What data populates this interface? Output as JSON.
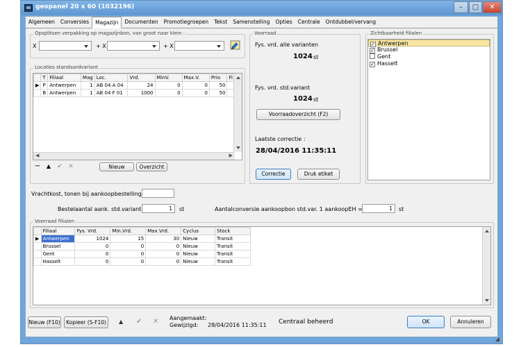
{
  "window": {
    "title": "geopanel 20 x 60 (1032196)",
    "min_glyph": "–",
    "max_glyph": "□",
    "close_glyph": "✕"
  },
  "tabs": [
    "Algemeen",
    "Conversies",
    "Magazijn",
    "Documenten",
    "Promotiegroepen",
    "Tekst",
    "Samenstelling",
    "Opties",
    "Centrale",
    "Ontdubbel/vervang"
  ],
  "active_tab": "Magazijn",
  "split": {
    "legend": "Opsplitsen verpakking op magazijnbon, van groot naar klein :",
    "labels": [
      "X",
      "+ X",
      "+ X"
    ],
    "values": [
      "",
      "",
      ""
    ]
  },
  "locaties": {
    "legend": "Locaties standaardvariant",
    "columns": [
      "T",
      "Filiaal",
      "Mag",
      "Loc.",
      "Vrd.",
      "MinV.",
      "Max.V.",
      "Prio",
      "Fi"
    ],
    "rows": [
      {
        "marker": "▶",
        "T": "P",
        "Filiaal": "Antwerpen",
        "Mag": "1",
        "Loc": "AB 04 A 04",
        "Vrd": "24",
        "MinV": "0",
        "MaxV": "0",
        "Prio": "50"
      },
      {
        "marker": "",
        "T": "B",
        "Filiaal": "Antwerpen",
        "Mag": "1",
        "Loc": "AB 04 F 01",
        "Vrd": "1000",
        "MinV": "0",
        "MaxV": "0",
        "Prio": "50"
      }
    ],
    "nav_glyphs": [
      "−",
      "▲",
      "✔",
      "✕"
    ],
    "new_label": "Nieuw",
    "overzicht_label": "Overzicht"
  },
  "voorraad": {
    "legend": "Voorraad",
    "alle_label": "Fys. vrd. alle varianten",
    "alle_value": "1024",
    "alle_unit": "st",
    "std_label": "Fys. vrd. std.variant",
    "std_value": "1024",
    "std_unit": "st",
    "overzicht_btn": "Voorraadoverzicht (F2)",
    "correctie_label": "Laatste correctie :",
    "correctie_value": "28/04/2016 11:35:11",
    "correctie_btn": "Correctie",
    "etiket_btn": "Druk etiket"
  },
  "zichtbaarheid": {
    "legend": "Zichtbaarheid filialen",
    "items": [
      {
        "label": "Antwerpen",
        "checked": true,
        "selected": true
      },
      {
        "label": "Brussel",
        "checked": true,
        "selected": false
      },
      {
        "label": "Gent",
        "checked": false,
        "selected": false
      },
      {
        "label": "Hasselt",
        "checked": true,
        "selected": false
      }
    ]
  },
  "vrachtkost": {
    "label": "Vrachtkost, tonen bij aankoopbestelling",
    "value": ""
  },
  "bestelaantal": {
    "label": "Bestelaantal aank. std.variant",
    "value": "1",
    "unit": "st"
  },
  "aantalconversie": {
    "label": "Aantalconversie aankoopbon std.var. 1 aankoopEH =",
    "value": "1",
    "unit": "st"
  },
  "filialen": {
    "legend": "Voorraad filialen",
    "columns": [
      "Filiaal",
      "Fys. Vrd.",
      "Min.Vrd.",
      "Max.Vrd.",
      "Cyclus",
      "Stock"
    ],
    "rows": [
      {
        "marker": "▶",
        "Filiaal": "Antwerpen",
        "Fys": "1024",
        "Min": "15",
        "Max": "30",
        "Cyclus": "Nieuw",
        "Stock": "Transit"
      },
      {
        "marker": "",
        "Filiaal": "Brussel",
        "Fys": "0",
        "Min": "0",
        "Max": "0",
        "Cyclus": "Nieuw",
        "Stock": "Transit"
      },
      {
        "marker": "",
        "Filiaal": "Gent",
        "Fys": "0",
        "Min": "0",
        "Max": "0",
        "Cyclus": "Nieuw",
        "Stock": "Transit"
      },
      {
        "marker": "",
        "Filiaal": "Hasselt",
        "Fys": "0",
        "Min": "0",
        "Max": "0",
        "Cyclus": "Nieuw",
        "Stock": "Transit"
      }
    ]
  },
  "footer": {
    "new_btn": "Nieuw (F10)",
    "copy_btn": "Kopieer (S-F10)",
    "up_glyph": "▲",
    "check_glyph": "✔",
    "cancel_glyph": "✕",
    "aangemaakt_label": "Aangemaakt:",
    "gewijzigd_label": "Gewijzigd:",
    "gewijzigd_value": "28/04/2016 11:35:11",
    "centraal": "Centraal beheerd",
    "ok_btn": "OK",
    "annuleren_btn": "Annuleren"
  },
  "colors": {
    "titlebar": "#6fa6dc",
    "selection": "#3c6fd1",
    "checklist_selected": "#f8e7a4"
  }
}
